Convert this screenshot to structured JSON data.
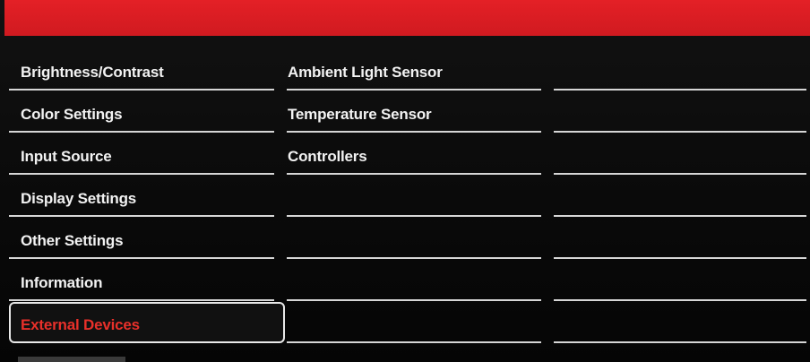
{
  "colors": {
    "header": "#e42026",
    "background": "#0b0b0b",
    "text": "#f2f2f2",
    "selected_text": "#e8302a",
    "divider": "#d6d6d6"
  },
  "main_menu": {
    "items": [
      {
        "label": "Brightness/Contrast"
      },
      {
        "label": "Color Settings"
      },
      {
        "label": "Input Source"
      },
      {
        "label": "Display Settings"
      },
      {
        "label": "Other Settings"
      },
      {
        "label": "Information"
      },
      {
        "label": "External Devices",
        "selected": true
      }
    ]
  },
  "submenu": {
    "items": [
      {
        "label": "Ambient Light Sensor"
      },
      {
        "label": "Temperature Sensor"
      },
      {
        "label": "Controllers"
      },
      {
        "label": ""
      },
      {
        "label": ""
      },
      {
        "label": ""
      },
      {
        "label": ""
      }
    ]
  }
}
